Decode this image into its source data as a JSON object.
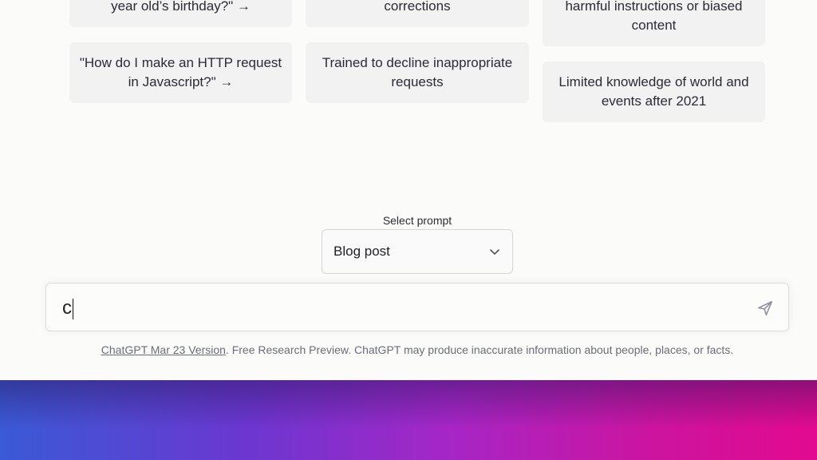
{
  "examples": [
    {
      "text": "year old’s birthday?\" →"
    },
    {
      "text": "\"How do I make an HTTP request in Javascript?\" →"
    }
  ],
  "capabilities": [
    {
      "text": "corrections"
    },
    {
      "text": "Trained to decline inappropriate requests"
    }
  ],
  "limitations": [
    {
      "text": "harmful instructions or biased content"
    },
    {
      "text": "Limited knowledge of world and events after 2021"
    }
  ],
  "prompt_select": {
    "label": "Select prompt",
    "value": "Blog post"
  },
  "composer": {
    "value": "c"
  },
  "footer": {
    "link": "ChatGPT Mar 23 Version",
    "text": ". Free Research Preview. ChatGPT may produce inaccurate information about people, places, or facts."
  }
}
